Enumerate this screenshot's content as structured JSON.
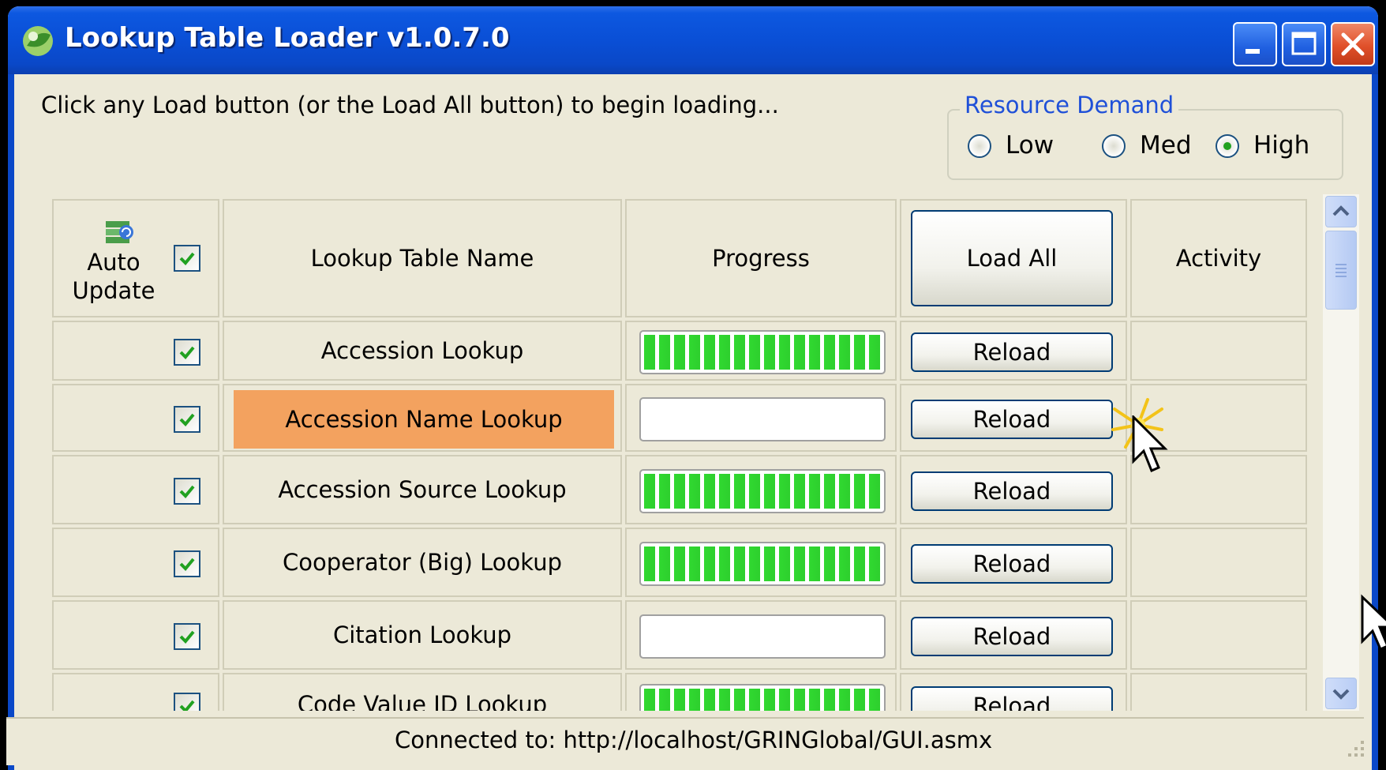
{
  "window": {
    "title": "Lookup Table Loader v1.0.7.0"
  },
  "instruction": "Click any Load button (or the Load All button) to begin loading...",
  "resource_demand": {
    "label": "Resource Demand",
    "options": [
      "Low",
      "Med",
      "High"
    ],
    "selected": "High"
  },
  "grid": {
    "headers": {
      "auto_update": "Auto Update",
      "name": "Lookup Table Name",
      "progress": "Progress",
      "load_all": "Load All",
      "activity": "Activity"
    },
    "header_auto_update_checked": true,
    "rows": [
      {
        "checked": true,
        "name": "Accession Lookup",
        "progress": 1.0,
        "button": "Reload",
        "highlighted": false
      },
      {
        "checked": true,
        "name": "Accession Name Lookup",
        "progress": 0.0,
        "button": "Reload",
        "highlighted": true
      },
      {
        "checked": true,
        "name": "Accession Source Lookup",
        "progress": 1.0,
        "button": "Reload",
        "highlighted": false
      },
      {
        "checked": true,
        "name": "Cooperator (Big) Lookup",
        "progress": 1.0,
        "button": "Reload",
        "highlighted": false
      },
      {
        "checked": true,
        "name": "Citation Lookup",
        "progress": 0.0,
        "button": "Reload",
        "highlighted": false
      },
      {
        "checked": true,
        "name": "Code Value ID Lookup",
        "progress": 1.0,
        "button": "Reload",
        "highlighted": false
      }
    ]
  },
  "status": {
    "connected_to": "Connected to: http://localhost/GRINGlobal/GUI.asmx"
  },
  "colors": {
    "titlebar": "#0a4fd6",
    "highlight_row": "#f3a25f",
    "progress_green": "#30d930",
    "group_label": "#1f50d8"
  }
}
